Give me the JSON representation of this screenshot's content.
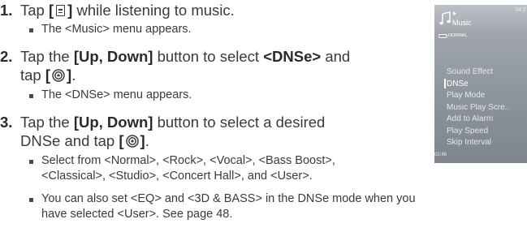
{
  "steps": [
    {
      "number": "1.",
      "line1": {
        "a": "Tap ",
        "b": "[",
        "c": "]",
        "d": " while listening to music."
      },
      "sub": "The <Music> menu appears."
    },
    {
      "number": "2.",
      "line1": {
        "a": "Tap the ",
        "b": "[Up, Down]",
        "c": " button to select ",
        "d": "<DNSe>",
        "e": " and"
      },
      "line2": {
        "a": "tap ",
        "b": "[",
        "c": "]",
        "d": "."
      },
      "sub": "The <DNSe> menu appears."
    },
    {
      "number": "3.",
      "line1": {
        "a": "Tap the ",
        "b": "[Up, Down]",
        "c": " button to select a desired"
      },
      "line2": {
        "a": "DNSe and tap ",
        "b": "[",
        "c": "]",
        "d": "."
      },
      "sub1_line1": "Select from <Normal>, <Rock>, <Vocal>, <Bass Boost>,",
      "sub1_line2": "<Classical>, <Studio>, <Concert Hall>, and <User>.",
      "sub2_line1": "You can also set <EQ> and <3D & BASS> in the DNSe mode when you",
      "sub2_line2": "have selected <User>. See page 48."
    }
  ],
  "device": {
    "title": "Music",
    "time": "04:2",
    "mode": "NORMAL",
    "menu_items": [
      "Sound Effect",
      "DNSe",
      "Play Mode",
      "Music Play Scre..",
      "Add to Alarm",
      "Play Speed",
      "Skip Interval"
    ],
    "selected_index": 1,
    "footer": "02:48"
  },
  "icons": {
    "menu": "menu-icon",
    "select": "select-button-icon",
    "music_note": "music-note-icon",
    "repeat": "repeat-icon"
  }
}
